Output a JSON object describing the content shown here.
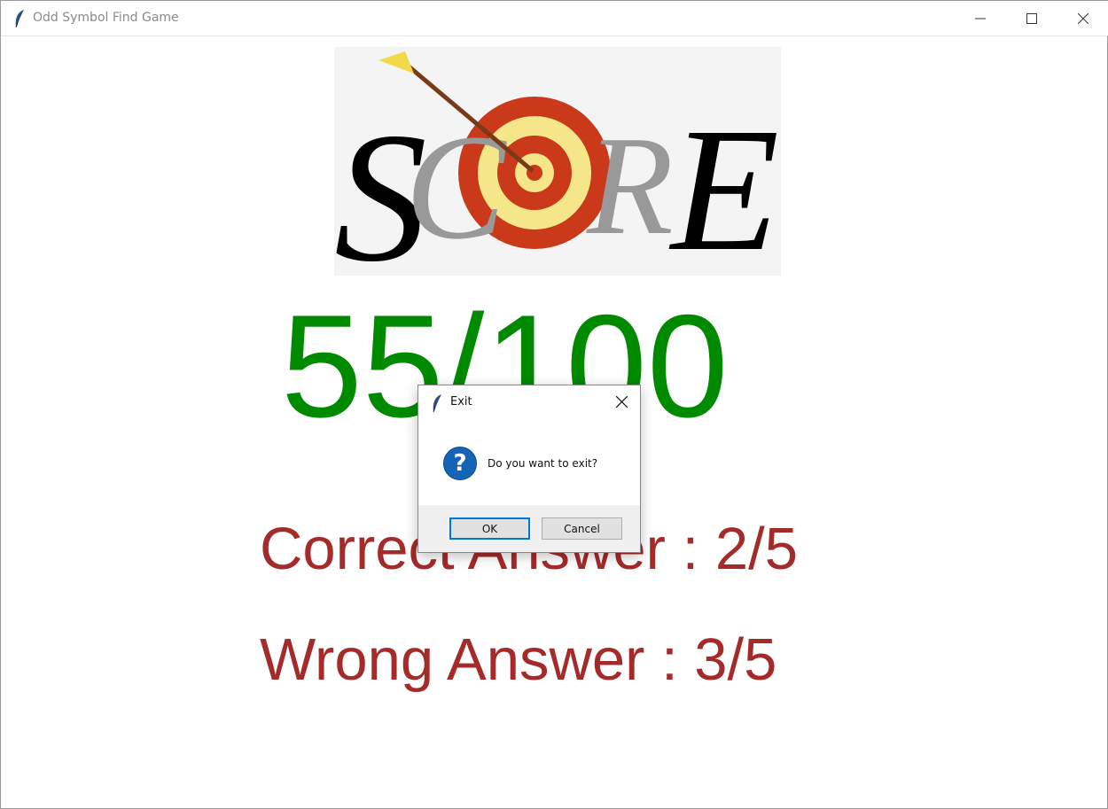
{
  "window": {
    "title": "Odd Symbol Find Game"
  },
  "logo": {
    "text": "SCORE"
  },
  "result": {
    "score": "55/100",
    "correct": "Correct Answer : 2/5",
    "wrong": "Wrong Answer : 3/5"
  },
  "dialog": {
    "title": "Exit",
    "message": "Do you want to exit?",
    "icon": "question-icon",
    "ok_label": "OK",
    "cancel_label": "Cancel"
  },
  "colors": {
    "score": "#008a00",
    "answers": "#a52a2a",
    "accent": "#0078d7"
  }
}
